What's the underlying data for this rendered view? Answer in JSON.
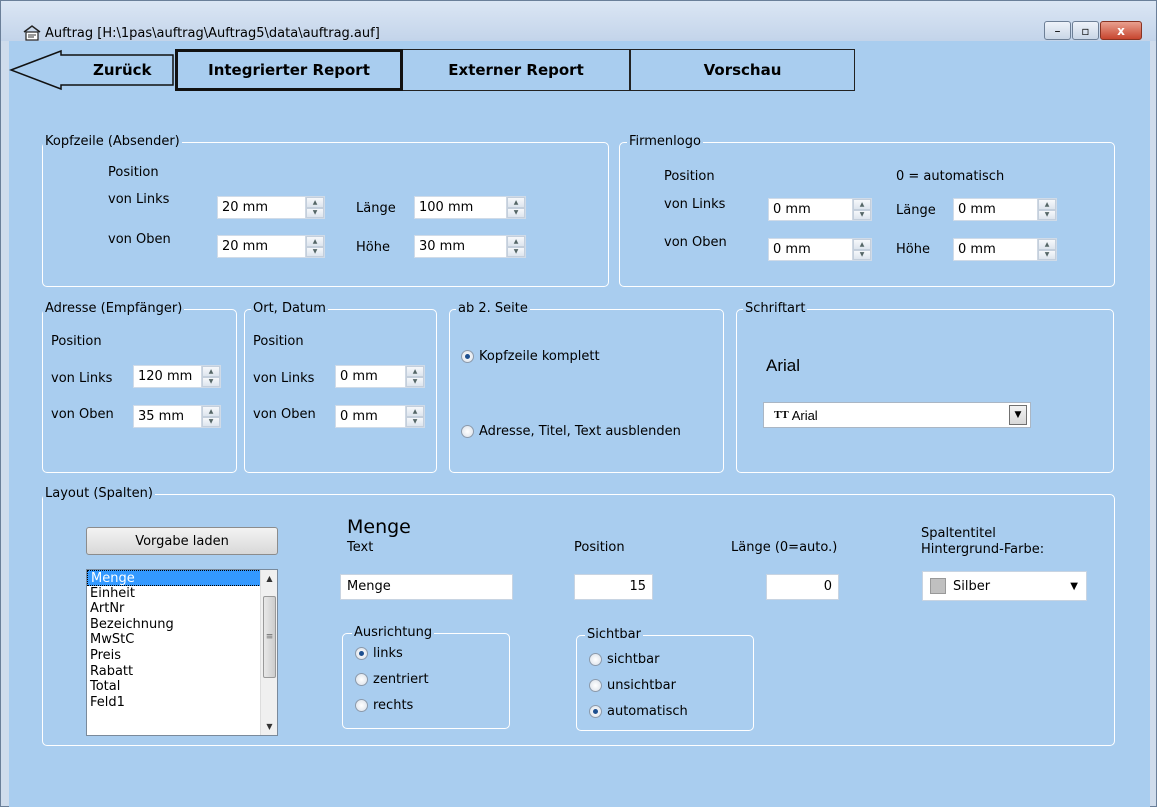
{
  "window": {
    "title": "Auftrag [H:\\1pas\\auftrag\\Auftrag5\\data\\auftrag.auf]",
    "close_symbol": "x",
    "min_symbol": "–",
    "max_symbol": "▫"
  },
  "nav": {
    "back_label": "Zurück",
    "tabs": [
      "Integrierter Report",
      "Externer Report",
      "Vorschau"
    ],
    "active_tab": "Integrierter Report"
  },
  "kopfzeile": {
    "legend": "Kopfzeile (Absender)",
    "position_label": "Position",
    "links_label": "von Links",
    "oben_label": "von Oben",
    "laenge_label": "Länge",
    "hoehe_label": "Höhe",
    "links_value": "20 mm",
    "oben_value": "20 mm",
    "laenge_value": "100 mm",
    "hoehe_value": "30 mm"
  },
  "firmenlogo": {
    "legend": "Firmenlogo",
    "position_label": "Position",
    "auto_note": "0 = automatisch",
    "links_label": "von Links",
    "oben_label": "von Oben",
    "laenge_label": "Länge",
    "hoehe_label": "Höhe",
    "links_value": "0 mm",
    "oben_value": "0 mm",
    "laenge_value": "0 mm",
    "hoehe_value": "0 mm"
  },
  "adresse": {
    "legend": "Adresse (Empfänger)",
    "position_label": "Position",
    "links_label": "von Links",
    "oben_label": "von Oben",
    "links_value": "120 mm",
    "oben_value": "35 mm"
  },
  "ortdatum": {
    "legend": "Ort, Datum",
    "position_label": "Position",
    "links_label": "von Links",
    "oben_label": "von Oben",
    "links_value": "0 mm",
    "oben_value": "0 mm"
  },
  "seite2": {
    "legend": "ab 2. Seite",
    "option1": "Kopfzeile komplett",
    "option2": "Adresse, Titel, Text ausblenden",
    "selected": "Kopfzeile komplett"
  },
  "schriftart": {
    "legend": "Schriftart",
    "preview": "Arial",
    "font_icon": "TT",
    "selected_font": "Arial"
  },
  "layout": {
    "legend": "Layout (Spalten)",
    "load_button": "Vorgabe laden",
    "columns": [
      "Menge",
      "Einheit",
      "ArtNr",
      "Bezeichnung",
      "MwStC",
      "Preis",
      "Rabatt",
      "Total",
      "Feld1"
    ],
    "selected_column": "Menge",
    "current_heading": "Menge",
    "text_label": "Text",
    "text_value": "Menge",
    "position_label": "Position",
    "position_value": "15",
    "laenge_label": "Länge (0=auto.)",
    "laenge_value": "0",
    "header_color_label_1": "Spaltentitel",
    "header_color_label_2": "Hintergrund-Farbe:",
    "header_color_value": "Silber",
    "alignment": {
      "legend": "Ausrichtung",
      "options": [
        "links",
        "zentriert",
        "rechts"
      ],
      "selected": "links"
    },
    "visibility": {
      "legend": "Sichtbar",
      "options": [
        "sichtbar",
        "unsichtbar",
        "automatisch"
      ],
      "selected": "automatisch"
    }
  },
  "colors": {
    "panel_bg": "#a9cdef",
    "selection": "#3399ff",
    "silver_swatch": "#c0c0c0"
  }
}
